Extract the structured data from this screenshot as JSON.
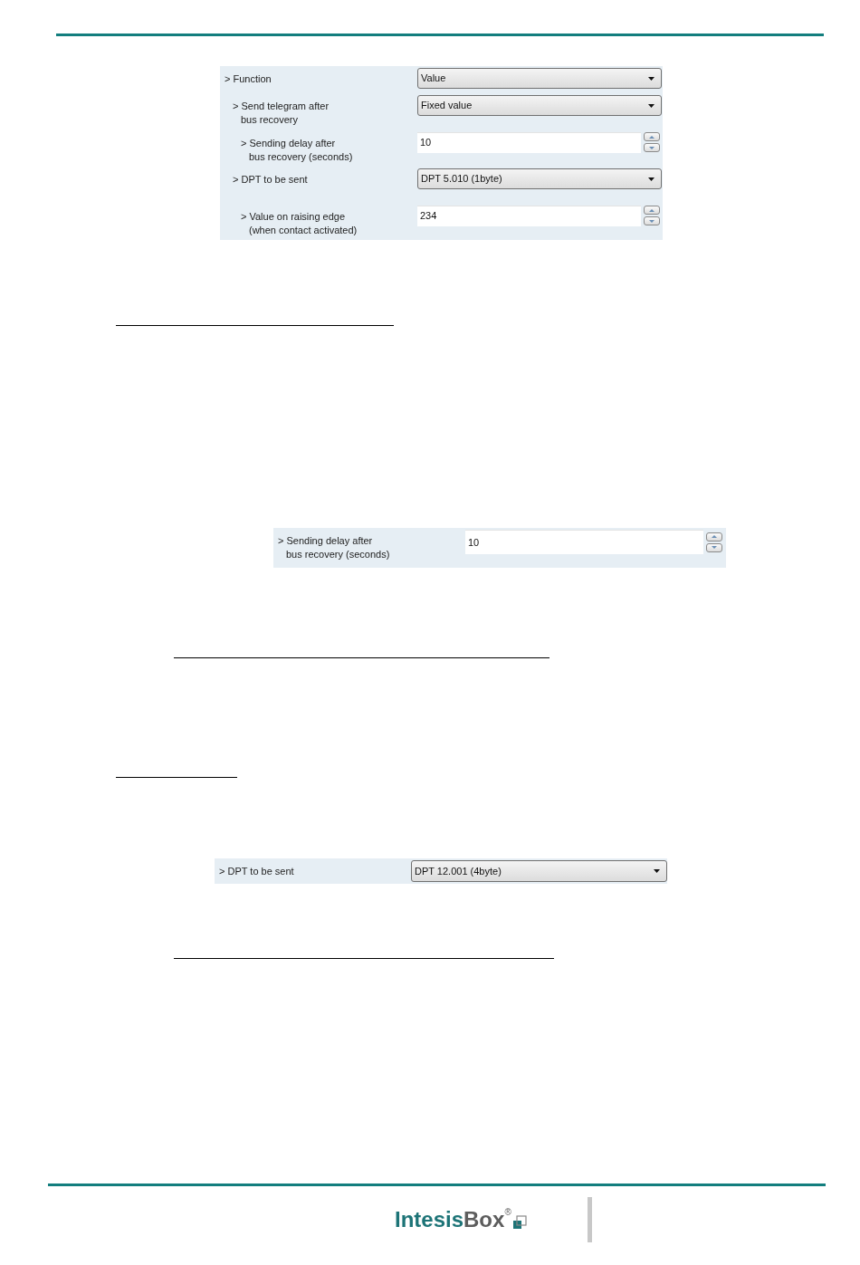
{
  "function_panel": {
    "rows": [
      {
        "label_lines": [
          "> Function"
        ],
        "field": {
          "kind": "dropdown",
          "value": "Value"
        },
        "children": [
          {
            "label_lines": [
              "> Send telegram after",
              "bus recovery"
            ],
            "field": {
              "kind": "dropdown",
              "value": "Fixed value"
            },
            "children": [
              {
                "label_lines": [
                  "> Sending delay after",
                  "bus recovery (seconds)"
                ],
                "field": {
                  "kind": "spin",
                  "value": "10"
                }
              }
            ]
          },
          {
            "label_lines": [
              "> DPT to be sent"
            ],
            "field": {
              "kind": "dropdown",
              "value": "DPT 5.010 (1byte)"
            },
            "children": [
              {
                "label_lines": [
                  "> Value on raising edge",
                  "(when contact activated)"
                ],
                "field": {
                  "kind": "spin",
                  "value": "234"
                }
              }
            ]
          }
        ]
      }
    ]
  },
  "delay_panel": {
    "rows": [
      {
        "label_lines": [
          "> Sending delay after",
          "bus recovery (seconds)"
        ],
        "field": {
          "kind": "spin",
          "value": "10"
        }
      }
    ]
  },
  "dpt_panel": {
    "rows": [
      {
        "label_lines": [
          "> DPT to be sent"
        ],
        "field": {
          "kind": "dropdown",
          "value": "DPT 12.001 (4byte)"
        }
      }
    ]
  },
  "footer": {
    "logo": {
      "primary": "Intesis",
      "secondary": "Box",
      "mark": "®"
    }
  }
}
